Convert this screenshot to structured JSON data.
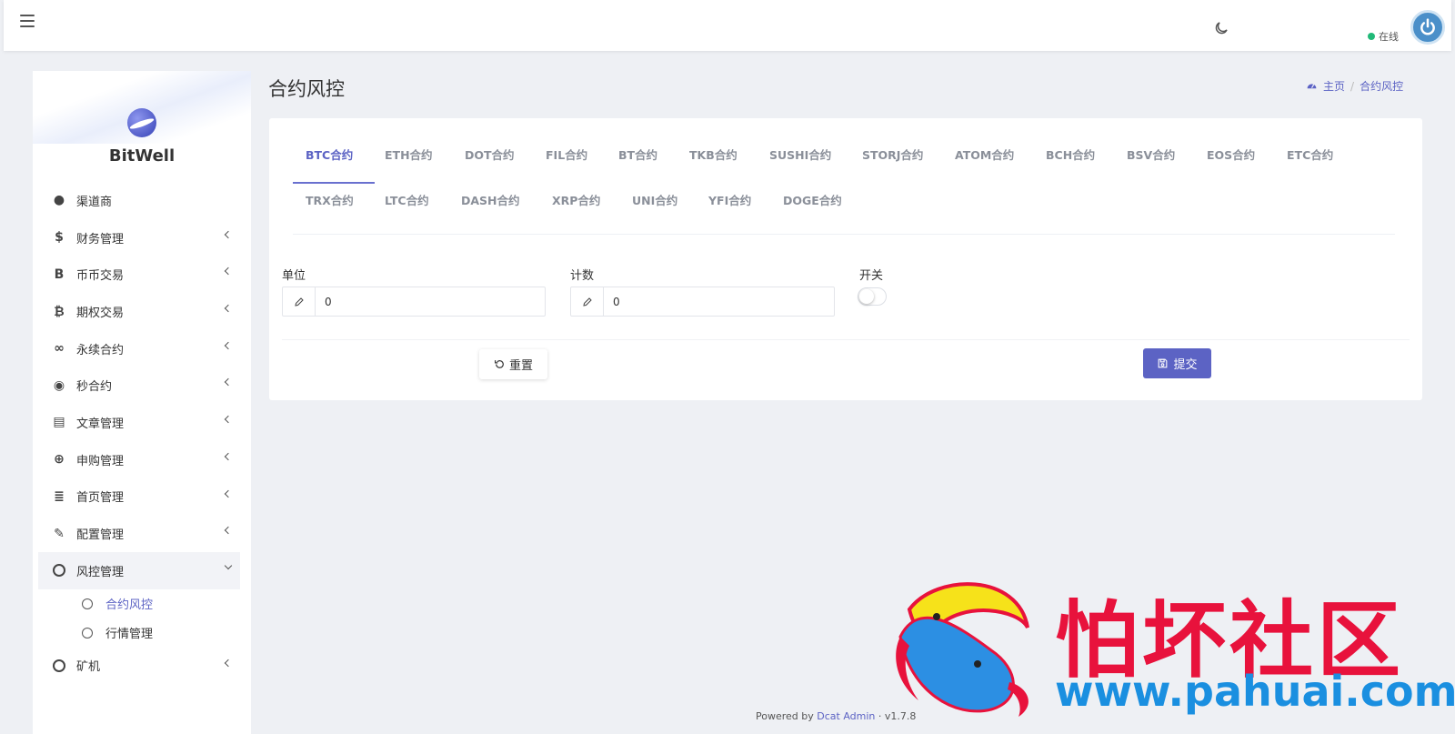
{
  "topbar": {
    "status_text": "在线"
  },
  "sidebar": {
    "brand": "BitWell",
    "items": [
      {
        "label": "渠道商",
        "icon": "user-circle-icon",
        "glyph": "●",
        "has_children": false
      },
      {
        "label": "财务管理",
        "icon": "dollar-icon",
        "glyph": "$",
        "has_children": true
      },
      {
        "label": "币币交易",
        "icon": "letter-b-icon",
        "glyph": "B",
        "has_children": true
      },
      {
        "label": "期权交易",
        "icon": "bitcoin-icon",
        "glyph": "₿",
        "has_children": true
      },
      {
        "label": "永续合约",
        "icon": "link-icon",
        "glyph": "∞",
        "has_children": true
      },
      {
        "label": "秒合约",
        "icon": "dot-circle-icon",
        "glyph": "◉",
        "has_children": true
      },
      {
        "label": "文章管理",
        "icon": "newspaper-icon",
        "glyph": "▤",
        "has_children": true
      },
      {
        "label": "申购管理",
        "icon": "life-ring-icon",
        "glyph": "⊕",
        "has_children": true
      },
      {
        "label": "首页管理",
        "icon": "list-icon",
        "glyph": "≣",
        "has_children": true
      },
      {
        "label": "配置管理",
        "icon": "wrench-icon",
        "glyph": "✎",
        "has_children": true
      },
      {
        "label": "风控管理",
        "icon": "circle-icon",
        "glyph": "",
        "has_children": true,
        "open": true
      },
      {
        "label": "矿机",
        "icon": "circle-icon",
        "glyph": "",
        "has_children": true
      }
    ],
    "submenu": [
      {
        "label": "合约风控",
        "active": true
      },
      {
        "label": "行情管理",
        "active": false
      }
    ]
  },
  "page": {
    "title": "合约风控",
    "breadcrumb": {
      "home": "主页",
      "current": "合约风控"
    }
  },
  "tabs": {
    "active_index": 0,
    "row1": [
      "BTC合约",
      "ETH合约",
      "DOT合约",
      "FIL合约",
      "BT合约",
      "TKB合约",
      "SUSHI合约",
      "STORJ合约",
      "ATOM合约",
      "BCH合约",
      "BSV合约",
      "EOS合约",
      "ETC合约"
    ],
    "row2": [
      "TRX合约",
      "LTC合约",
      "DASH合约",
      "XRP合约",
      "UNI合约",
      "YFI合约",
      "DOGE合约"
    ]
  },
  "form": {
    "unit_label": "单位",
    "unit_value": "0",
    "count_label": "计数",
    "count_value": "0",
    "switch_label": "开关",
    "switch_on": false,
    "reset_label": "重置",
    "submit_label": "提交"
  },
  "footer": {
    "powered_by": "Powered by",
    "link": "Dcat Admin",
    "sep": "·",
    "version": "v1.7.8"
  },
  "watermark": {
    "text": "怕坏社区",
    "url": "www.pahuai.com"
  },
  "colors": {
    "accent": "#5c63c4",
    "status_online": "#21b978",
    "watermark_red": "#e8123c",
    "watermark_blue": "#1a8fe0"
  }
}
